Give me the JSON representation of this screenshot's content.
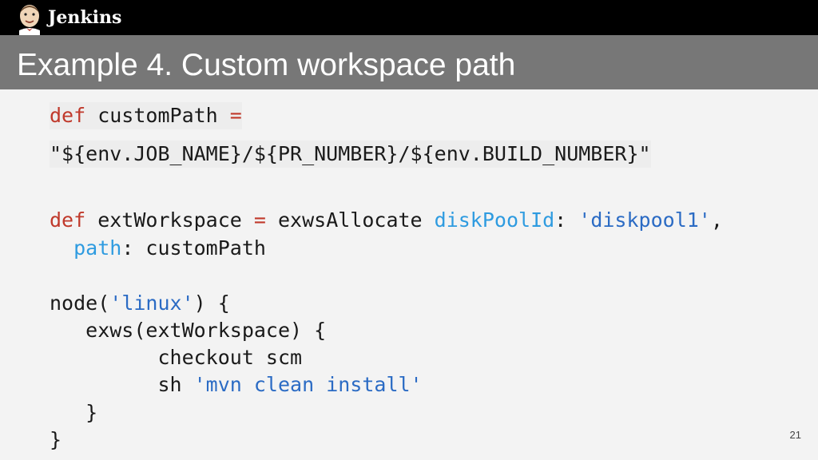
{
  "header": {
    "brand": "Jenkins",
    "logo_icon": "jenkins-butler-icon"
  },
  "slide": {
    "title": "Example 4. Custom workspace path",
    "page_number": "21"
  },
  "code": {
    "line1": {
      "kw": "def",
      "text": " customPath ",
      "sym": "="
    },
    "line2": {
      "text": "\"${env.JOB_NAME}/${PR_NUMBER}/${env.BUILD_NUMBER}\""
    },
    "line3": {
      "kw": "def",
      "text1": " extWorkspace ",
      "sym": "=",
      "text2": " exwsAllocate ",
      "param": "diskPoolId",
      "text3": ": ",
      "str": "'diskpool1'",
      "text4": ","
    },
    "line4": {
      "indent": "  ",
      "param": "path",
      "text": ": customPath"
    },
    "line5": {
      "text1": "node(",
      "str": "'linux'",
      "text2": ") {"
    },
    "line6": {
      "text": "   exws(extWorkspace) {"
    },
    "line7": {
      "text": "         checkout scm"
    },
    "line8": {
      "text": "         sh ",
      "str": "'mvn clean install'"
    },
    "line9": {
      "text": "   }"
    },
    "line10": {
      "text": "}"
    }
  },
  "colors": {
    "keyword": "#c0392b",
    "string": "#2b6bc4",
    "param": "#2e9be0",
    "title_bar": "#777777",
    "top_bar": "#000000"
  }
}
